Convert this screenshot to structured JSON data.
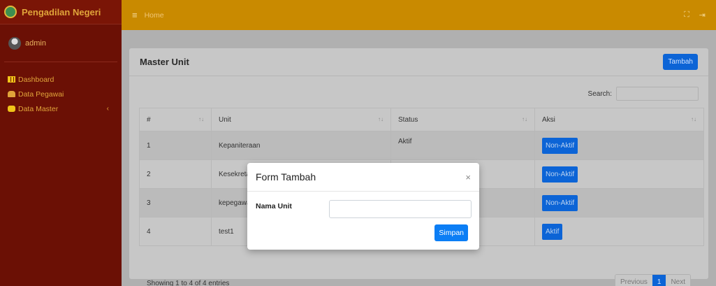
{
  "sidebar": {
    "brand": "Pengadilan Negeri",
    "user": "admin",
    "items": [
      {
        "label": "Dashboard"
      },
      {
        "label": "Data Pegawai"
      },
      {
        "label": "Data Master",
        "arrow": "‹"
      }
    ]
  },
  "topbar": {
    "menu_icon": "≡",
    "home": "Home",
    "fullscreen_icon": "⛶",
    "logout_icon": "⇥"
  },
  "card": {
    "title": "Master Unit",
    "add_button": "Tambah",
    "search_label": "Search:",
    "columns": [
      "#",
      "Unit",
      "Status",
      "Aksi"
    ],
    "rows": [
      {
        "no": "1",
        "unit": "Kepaniteraan",
        "status": "Aktif",
        "action": "Non-Aktif"
      },
      {
        "no": "2",
        "unit": "Kesekretariatan",
        "status": "",
        "action": "Non-Aktif"
      },
      {
        "no": "3",
        "unit": "kepegawaian",
        "status": "",
        "action": "Non-Aktif"
      },
      {
        "no": "4",
        "unit": "test1",
        "status": "",
        "action": "Aktif"
      }
    ],
    "info": "Showing 1 to 4 of 4 entries",
    "pagination": {
      "previous": "Previous",
      "page": "1",
      "next": "Next"
    }
  },
  "modal": {
    "title": "Form Tambah",
    "close": "×",
    "field_label": "Nama Unit",
    "field_value": "",
    "submit": "Simpan"
  },
  "colors": {
    "sidebar": "#6b1005",
    "topbar": "#c98a00",
    "primary": "#0c64d6"
  }
}
